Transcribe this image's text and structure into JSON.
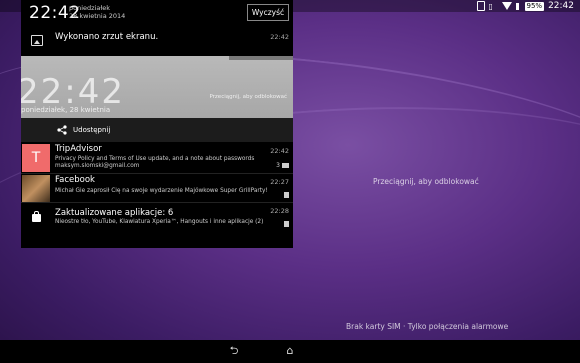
{
  "status_bar": {
    "battery": "95%",
    "time": "22:42"
  },
  "panel": {
    "time": "22:42",
    "day": "poniedziałek",
    "date": "28 kwietnia 2014",
    "clear_label": "Wyczyść"
  },
  "screenshot_notification": {
    "title": "Wykonano zrzut ekranu.",
    "time": "22:42",
    "preview": {
      "time": "22:42",
      "date": "poniedziałek, 28 kwietnia",
      "hint": "Przeciągnij, aby odblokować"
    },
    "share_label": "Udostępnij"
  },
  "notifications": [
    {
      "avatar_letter": "T",
      "title": "TripAdvisor",
      "line1": "Privacy Policy and Terms of Use update, and a note about passwords",
      "line2": "maksym.slomski@gmail.com",
      "time": "22:42",
      "badge": "3"
    },
    {
      "title": "Facebook",
      "line1": "Michał Gie zaprosił Cię na swoje wydarzenie Majówkowe Super GrillParty!",
      "time": "22:27"
    },
    {
      "title": "Zaktualizowane aplikacje: 6",
      "line1": "Nieostre tło, YouTube, Klawiatura Xperia™, Hangouts i inne aplikacje (2)",
      "time": "22:28"
    }
  ],
  "lockscreen": {
    "unlock_hint": "Przeciągnij, aby odblokować",
    "sim_status": "Brak karty SIM · Tylko połączenia alarmowe"
  },
  "icons": {
    "back": "back-icon",
    "home": "home-icon",
    "share": "share-icon",
    "image": "image-icon"
  },
  "colors": {
    "tripadvisor_avatar": "#f06b6b",
    "wallpaper": "#5b2f86"
  }
}
